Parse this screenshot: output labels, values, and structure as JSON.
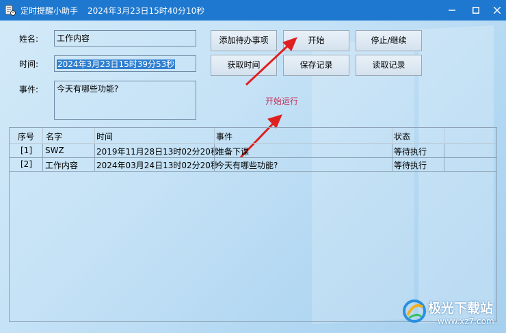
{
  "window": {
    "title": "定时提醒小助手",
    "current_time": "2024年3月23日15时40分10秒"
  },
  "form": {
    "name_label": "姓名:",
    "name_value": "工作内容",
    "time_label": "时间:",
    "time_value": "2024年3月23日15时39分53秒",
    "event_label": "事件:",
    "event_value": "今天有哪些功能?"
  },
  "buttons": {
    "add": "添加待办事项",
    "start": "开始",
    "pause": "停止/继续",
    "get_time": "获取时间",
    "save": "保存记录",
    "load": "读取记录"
  },
  "status_text": "开始运行",
  "table": {
    "headers": [
      "序号",
      "名字",
      "时间",
      "事件",
      "状态"
    ],
    "rows": [
      [
        "[1]",
        "SWZ",
        "2019年11月28日13时02分20秒",
        "准备下课",
        "等待执行"
      ],
      [
        "[2]",
        "工作内容",
        "2024年03月24日13时02分20秒",
        "今天有哪些功能?",
        "等待执行"
      ]
    ]
  },
  "watermark": {
    "text": "极光下载站",
    "url": "www.xz7.com"
  },
  "colors": {
    "titlebar": "#1e78cf",
    "arrow": "#e02020",
    "status_text": "#c0305a",
    "selection": "#2f7fd0"
  }
}
